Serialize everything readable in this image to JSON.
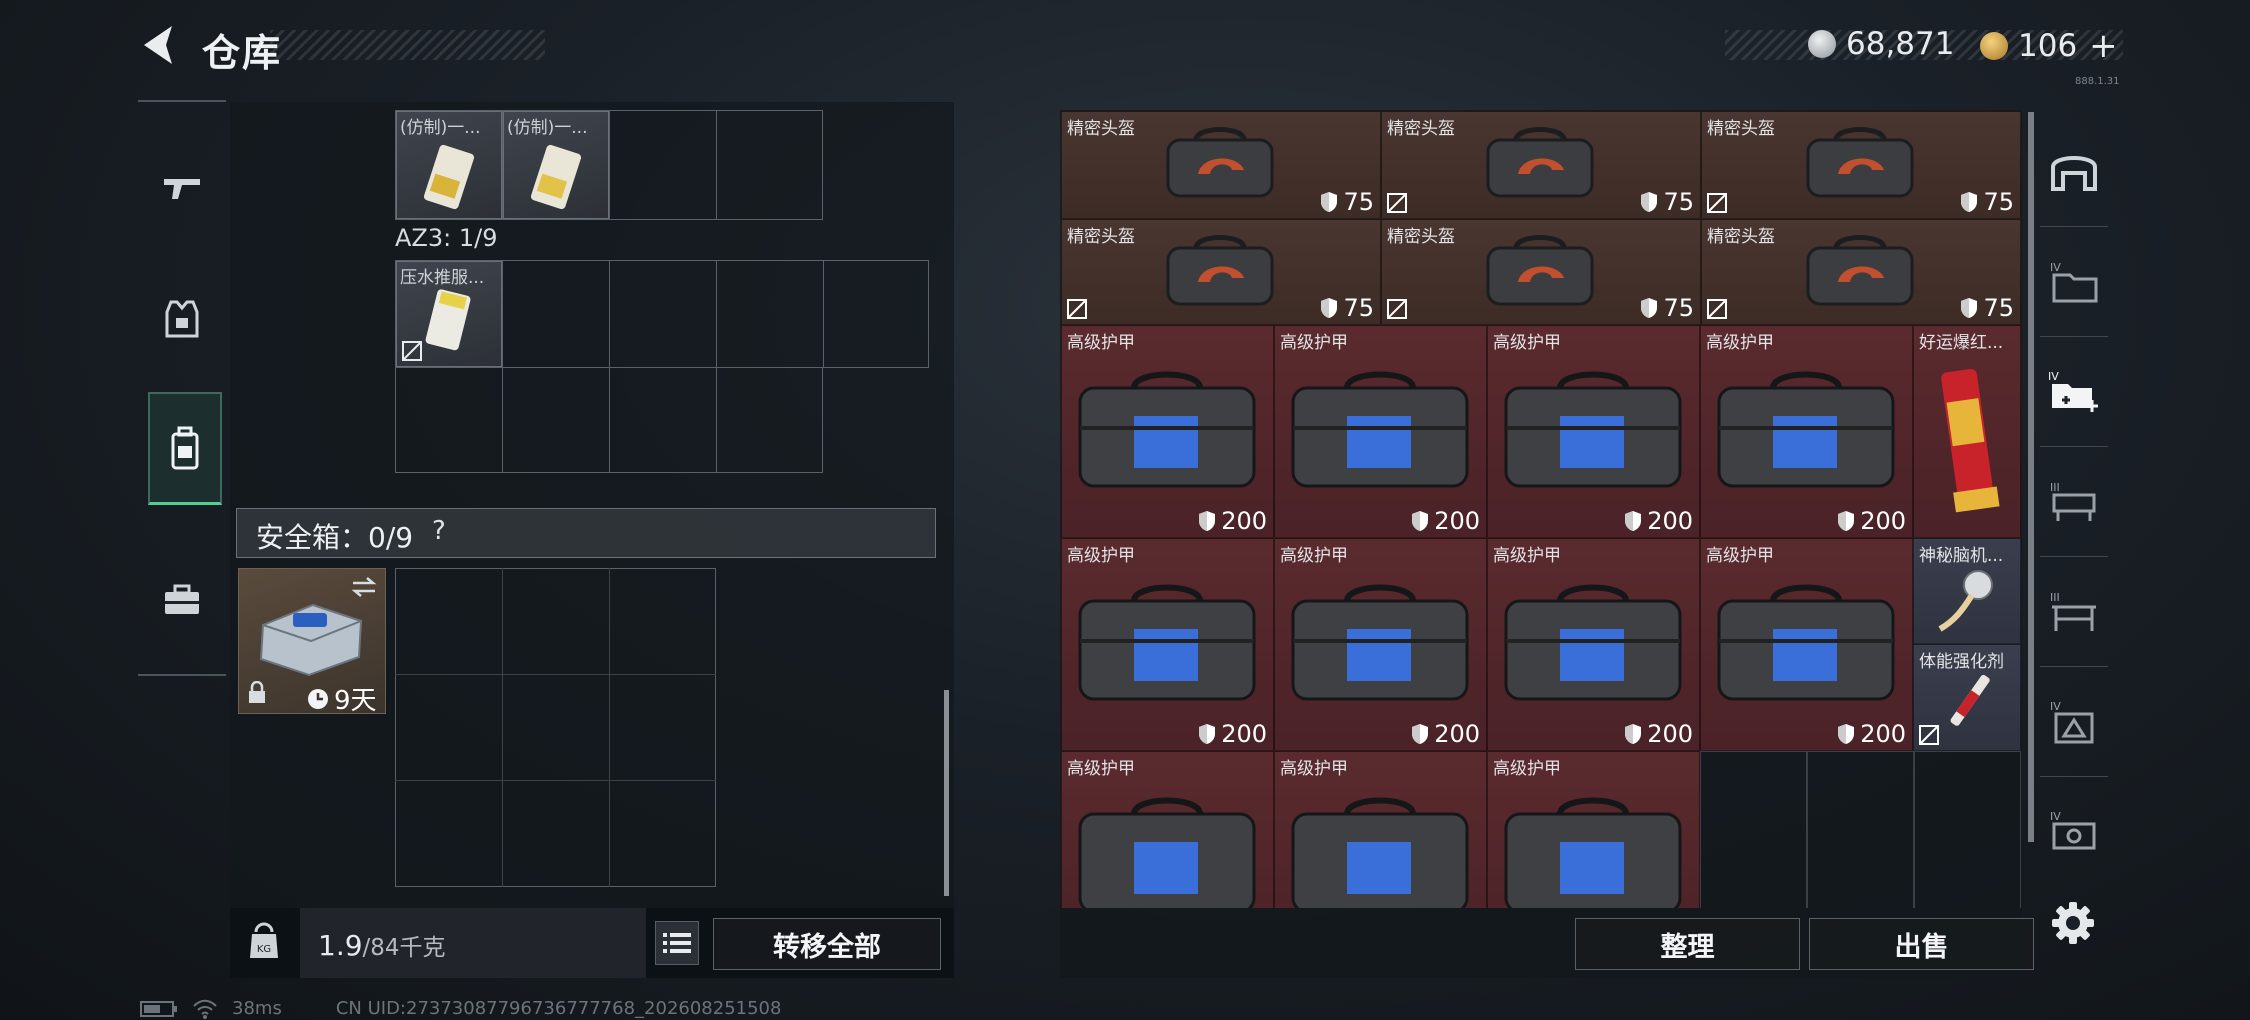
{
  "header": {
    "title": "仓库",
    "currency1_value": "68,871",
    "currency2_value": "106",
    "currency2_plus": "+",
    "tiny_text": "888.1.31",
    "colors": {
      "currency1": "#c8ccd0",
      "currency2": "#d6a548"
    }
  },
  "left_nav": {
    "items": [
      {
        "icon": "gun-icon"
      },
      {
        "icon": "armor-vest-icon"
      },
      {
        "icon": "backpack-icon",
        "active": true
      },
      {
        "icon": "toolbox-icon"
      }
    ]
  },
  "pouch": {
    "top_items": [
      {
        "name": "(仿制)一..."
      },
      {
        "name": "(仿制)一..."
      }
    ],
    "az3_label": "AZ3: 1/9",
    "az3_item": {
      "name": "压水推服..."
    }
  },
  "safe": {
    "label": "安全箱：0/9",
    "help": "?",
    "days": "9天"
  },
  "bottom_left": {
    "weight_value": "1.9",
    "weight_unit": "/84千克",
    "transfer_all": "转移全部"
  },
  "inventory": {
    "helmets": [
      {
        "name": "精密头盔",
        "value": "75"
      },
      {
        "name": "精密头盔",
        "value": "75"
      },
      {
        "name": "精密头盔",
        "value": "75"
      },
      {
        "name": "精密头盔",
        "value": "75"
      },
      {
        "name": "精密头盔",
        "value": "75"
      },
      {
        "name": "精密头盔",
        "value": "75"
      }
    ],
    "armors": [
      {
        "name": "高级护甲",
        "value": "200"
      },
      {
        "name": "高级护甲",
        "value": "200"
      },
      {
        "name": "高级护甲",
        "value": "200"
      },
      {
        "name": "高级护甲",
        "value": "200"
      },
      {
        "name": "高级护甲",
        "value": "200"
      },
      {
        "name": "高级护甲",
        "value": "200"
      },
      {
        "name": "高级护甲",
        "value": "200"
      },
      {
        "name": "高级护甲",
        "value": "200"
      },
      {
        "name": "高级护甲",
        "value": ""
      },
      {
        "name": "高级护甲",
        "value": ""
      },
      {
        "name": "高级护甲",
        "value": ""
      }
    ],
    "misc": [
      {
        "name": "好运爆红..."
      },
      {
        "name": "神秘脑机..."
      },
      {
        "name": "体能强化剂"
      }
    ]
  },
  "bottom_right": {
    "organize": "整理",
    "sell": "出售"
  },
  "right_nav": {
    "items": [
      {
        "icon": "bunker-icon",
        "tier": ""
      },
      {
        "icon": "storage-folder-icon",
        "tier": "IV"
      },
      {
        "icon": "storage-add-icon",
        "tier": "IV"
      },
      {
        "icon": "craft-bench-icon",
        "tier": "III"
      },
      {
        "icon": "workbench-icon",
        "tier": "III"
      },
      {
        "icon": "medical-station-icon",
        "tier": "IV"
      },
      {
        "icon": "generator-icon",
        "tier": "IV"
      }
    ],
    "settings_icon": "gear-icon"
  },
  "status": {
    "ping": "38ms",
    "uid": "CN UID:27373087796736777768_202608251508"
  }
}
